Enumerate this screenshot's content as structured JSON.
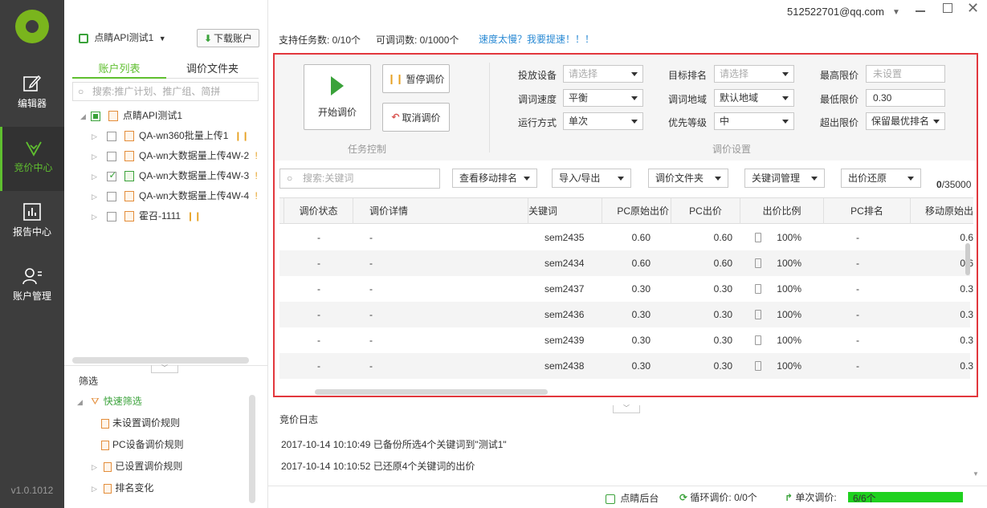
{
  "nav": {
    "items": [
      {
        "label": "编辑器"
      },
      {
        "label": "竞价中心"
      },
      {
        "label": "报告中心"
      },
      {
        "label": "账户管理"
      }
    ],
    "version": "v1.0.1012",
    "active_color": "#5fbf2f"
  },
  "account": {
    "name": "点睛API测试1",
    "download": "下载账户"
  },
  "tabs": [
    "账户列表",
    "调价文件夹"
  ],
  "search": {
    "placeholder": "搜索:推广计划、推广组、简拼"
  },
  "tree": {
    "root": "点睛API测试1",
    "items": [
      "QA-wn360批量上传1",
      "QA-wn大数据量上传4W-2",
      "QA-wn大数据量上传4W-3",
      "QA-wn大数据量上传4W-4",
      "霍召-1111"
    ]
  },
  "filter": {
    "title": "筛选",
    "quick": "快速筛选",
    "items": [
      "未设置调价规则",
      "PC设备调价规则",
      "已设置调价规则",
      "排名变化"
    ]
  },
  "topbar": {
    "user": "512522701@qq.com",
    "tasks": "支持任务数: 0/10个",
    "words": "可调词数: 0/1000个",
    "speed_link": "速度太慢？我要提速！！！"
  },
  "task": {
    "start": "开始调价",
    "pause": "暂停调价",
    "cancel": "取消调价",
    "section": "任务控制"
  },
  "settings": {
    "section": "调价设置",
    "device_label": "投放设备",
    "device_ph": "请选择",
    "rank_label": "目标排名",
    "rank_ph": "请选择",
    "max_label": "最高限价",
    "max_ph": "未设置",
    "speed_label": "调词速度",
    "speed_val": "平衡",
    "region_label": "调词地域",
    "region_val": "默认地域",
    "min_label": "最低限价",
    "min_val": "0.30",
    "mode_label": "运行方式",
    "mode_val": "单次",
    "priority_label": "优先等级",
    "priority_val": "中",
    "exceed_label": "超出限价",
    "exceed_val": "保留最优排名"
  },
  "toolbar": {
    "search_ph": "搜索:关键词",
    "btn1": "查看移动排名",
    "btn2": "导入/导出",
    "btn3": "调价文件夹",
    "btn4": "关键词管理",
    "btn5": "出价还原",
    "count_a": "0",
    "count_b": "/35000"
  },
  "table": {
    "headers": [
      "调价状态",
      "调价详情",
      "关键词",
      "PC原始出价",
      "PC出价",
      "出价比例",
      "PC排名",
      "移动原始出"
    ],
    "rows": [
      [
        "-",
        "-",
        "sem2435",
        "0.60",
        "0.60",
        "100%",
        "-",
        "0.6"
      ],
      [
        "-",
        "-",
        "sem2434",
        "0.60",
        "0.60",
        "100%",
        "-",
        "0.6"
      ],
      [
        "-",
        "-",
        "sem2437",
        "0.30",
        "0.30",
        "100%",
        "-",
        "0.3"
      ],
      [
        "-",
        "-",
        "sem2436",
        "0.30",
        "0.30",
        "100%",
        "-",
        "0.3"
      ],
      [
        "-",
        "-",
        "sem2439",
        "0.30",
        "0.30",
        "100%",
        "-",
        "0.3"
      ],
      [
        "-",
        "-",
        "sem2438",
        "0.30",
        "0.30",
        "100%",
        "-",
        "0.3"
      ]
    ]
  },
  "log": {
    "title": "竞价日志",
    "lines": [
      "2017-10-14 10:10:49 已备份所选4个关键词到\"测试1\"",
      "2017-10-14 10:10:52 已还原4个关键词的出价"
    ]
  },
  "status": {
    "backend": "点睛后台",
    "cycle": "循环调价: 0/0个",
    "single": "单次调价:",
    "single_val": "6/6个"
  }
}
